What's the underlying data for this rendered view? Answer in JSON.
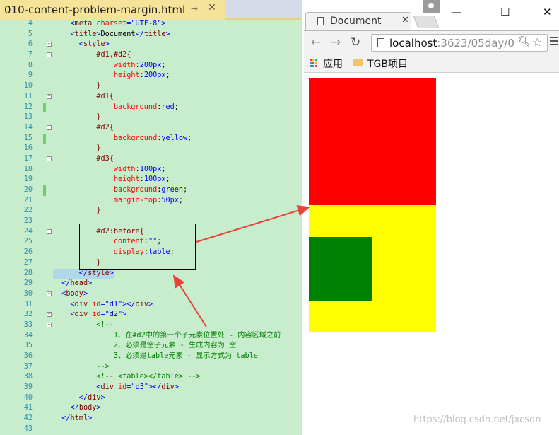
{
  "editor": {
    "tab_title": "010-content-problem-margin.html",
    "lines": [
      {
        "n": "4",
        "html": [
          [
            "t-pun",
            "    <"
          ],
          [
            "t-tag",
            "meta "
          ],
          [
            "t-attr",
            "charset"
          ],
          [
            "t-pun",
            "="
          ],
          [
            "t-str",
            "\"UTF-8\""
          ],
          [
            "t-pun",
            ">"
          ]
        ]
      },
      {
        "n": "5",
        "html": [
          [
            "t-pun",
            "    <"
          ],
          [
            "t-tag",
            "title"
          ],
          [
            "t-pun",
            ">"
          ],
          [
            "t-text",
            "Document"
          ],
          [
            "t-pun",
            "</"
          ],
          [
            "t-tag",
            "title"
          ],
          [
            "t-pun",
            ">"
          ]
        ]
      },
      {
        "n": "6",
        "html": [
          [
            "t-pun",
            "      <"
          ],
          [
            "t-tag",
            "style"
          ],
          [
            "t-pun",
            ">"
          ]
        ]
      },
      {
        "n": "7",
        "html": [
          [
            "t-sel",
            "          #d1,#d2{"
          ]
        ]
      },
      {
        "n": "8",
        "html": [
          [
            "t-prop",
            "              width"
          ],
          [
            "t-text",
            ":"
          ],
          [
            "t-val",
            "200px"
          ],
          [
            "t-text",
            ";"
          ]
        ]
      },
      {
        "n": "9",
        "html": [
          [
            "t-prop",
            "              height"
          ],
          [
            "t-text",
            ":"
          ],
          [
            "t-val",
            "200px"
          ],
          [
            "t-text",
            ";"
          ]
        ]
      },
      {
        "n": "10",
        "html": [
          [
            "t-sel",
            "          }"
          ]
        ]
      },
      {
        "n": "11",
        "html": [
          [
            "t-sel",
            "          #d1{"
          ]
        ]
      },
      {
        "n": "12",
        "html": [
          [
            "t-prop",
            "              background"
          ],
          [
            "t-text",
            ":"
          ],
          [
            "t-val",
            "red"
          ],
          [
            "t-text",
            ";"
          ]
        ]
      },
      {
        "n": "13",
        "html": [
          [
            "t-sel",
            "          }"
          ]
        ]
      },
      {
        "n": "14",
        "html": [
          [
            "t-sel",
            "          #d2{"
          ]
        ]
      },
      {
        "n": "15",
        "html": [
          [
            "t-prop",
            "              background"
          ],
          [
            "t-text",
            ":"
          ],
          [
            "t-val",
            "yellow"
          ],
          [
            "t-text",
            ";"
          ]
        ]
      },
      {
        "n": "16",
        "html": [
          [
            "t-sel",
            "          }"
          ]
        ]
      },
      {
        "n": "17",
        "html": [
          [
            "t-sel",
            "          #d3{"
          ]
        ]
      },
      {
        "n": "18",
        "html": [
          [
            "t-prop",
            "              width"
          ],
          [
            "t-text",
            ":"
          ],
          [
            "t-val",
            "100px"
          ],
          [
            "t-text",
            ";"
          ]
        ]
      },
      {
        "n": "19",
        "html": [
          [
            "t-prop",
            "              height"
          ],
          [
            "t-text",
            ":"
          ],
          [
            "t-val",
            "100px"
          ],
          [
            "t-text",
            ";"
          ]
        ]
      },
      {
        "n": "20",
        "html": [
          [
            "t-prop",
            "              background"
          ],
          [
            "t-text",
            ":"
          ],
          [
            "t-val",
            "green"
          ],
          [
            "t-text",
            ";"
          ]
        ]
      },
      {
        "n": "21",
        "html": [
          [
            "t-prop",
            "              margin-top"
          ],
          [
            "t-text",
            ":"
          ],
          [
            "t-val",
            "50px"
          ],
          [
            "t-text",
            ";"
          ]
        ]
      },
      {
        "n": "22",
        "html": [
          [
            "t-sel",
            "          }"
          ]
        ]
      },
      {
        "n": "23",
        "html": [
          [
            "t-text",
            ""
          ]
        ]
      },
      {
        "n": "24",
        "html": [
          [
            "t-sel",
            "          #d2:before{"
          ]
        ]
      },
      {
        "n": "25",
        "html": [
          [
            "t-prop",
            "              content"
          ],
          [
            "t-text",
            ":"
          ],
          [
            "t-val",
            "\"\""
          ],
          [
            "t-text",
            ";"
          ]
        ]
      },
      {
        "n": "26",
        "html": [
          [
            "t-prop",
            "              display"
          ],
          [
            "t-text",
            ":"
          ],
          [
            "t-val",
            "table"
          ],
          [
            "t-text",
            ";"
          ]
        ]
      },
      {
        "n": "27",
        "html": [
          [
            "t-sel",
            "          }"
          ]
        ]
      },
      {
        "n": "28",
        "html": [
          [
            "t-pun",
            "      </"
          ],
          [
            "t-tag",
            "style"
          ],
          [
            "t-pun",
            ">"
          ]
        ]
      },
      {
        "n": "29",
        "html": [
          [
            "t-pun",
            "  </"
          ],
          [
            "t-tag",
            "head"
          ],
          [
            "t-pun",
            ">"
          ]
        ]
      },
      {
        "n": "30",
        "html": [
          [
            "t-pun",
            "  <"
          ],
          [
            "t-tag",
            "body"
          ],
          [
            "t-pun",
            ">"
          ]
        ]
      },
      {
        "n": "31",
        "html": [
          [
            "t-pun",
            "    <"
          ],
          [
            "t-tag",
            "div "
          ],
          [
            "t-attr",
            "id"
          ],
          [
            "t-pun",
            "="
          ],
          [
            "t-str",
            "\"d1\""
          ],
          [
            "t-pun",
            "></"
          ],
          [
            "t-tag",
            "div"
          ],
          [
            "t-pun",
            ">"
          ]
        ]
      },
      {
        "n": "32",
        "html": [
          [
            "t-pun",
            "    <"
          ],
          [
            "t-tag",
            "div "
          ],
          [
            "t-attr",
            "id"
          ],
          [
            "t-pun",
            "="
          ],
          [
            "t-str",
            "\"d2\""
          ],
          [
            "t-pun",
            ">"
          ]
        ]
      },
      {
        "n": "33",
        "html": [
          [
            "t-cmt",
            "          <!--"
          ]
        ]
      },
      {
        "n": "34",
        "html": [
          [
            "t-cmt",
            "              1、在#d2中的第一个子元素位置处 - 内容区域之前"
          ]
        ]
      },
      {
        "n": "35",
        "html": [
          [
            "t-cmt",
            "              2、必须是空子元素 - 生成内容为 空"
          ]
        ]
      },
      {
        "n": "36",
        "html": [
          [
            "t-cmt",
            "              3、必须是table元素 - 显示方式为 table"
          ]
        ]
      },
      {
        "n": "37",
        "html": [
          [
            "t-cmt",
            "          -->"
          ]
        ]
      },
      {
        "n": "38",
        "html": [
          [
            "t-cmt",
            "          <!-- <table></table> -->"
          ]
        ]
      },
      {
        "n": "39",
        "html": [
          [
            "t-pun",
            "          <"
          ],
          [
            "t-tag",
            "div "
          ],
          [
            "t-attr",
            "id"
          ],
          [
            "t-pun",
            "="
          ],
          [
            "t-str",
            "\"d3\""
          ],
          [
            "t-pun",
            "></"
          ],
          [
            "t-tag",
            "div"
          ],
          [
            "t-pun",
            ">"
          ]
        ]
      },
      {
        "n": "40",
        "html": [
          [
            "t-pun",
            "      </"
          ],
          [
            "t-tag",
            "div"
          ],
          [
            "t-pun",
            ">"
          ]
        ]
      },
      {
        "n": "41",
        "html": [
          [
            "t-pun",
            "    </"
          ],
          [
            "t-tag",
            "body"
          ],
          [
            "t-pun",
            ">"
          ]
        ]
      },
      {
        "n": "42",
        "html": [
          [
            "t-pun",
            "  </"
          ],
          [
            "t-tag",
            "html"
          ],
          [
            "t-pun",
            ">"
          ]
        ]
      },
      {
        "n": "43",
        "html": [
          [
            "t-text",
            ""
          ]
        ]
      }
    ],
    "fold_lines": [
      "6",
      "7",
      "11",
      "14",
      "17",
      "24",
      "30",
      "32",
      "33"
    ],
    "changed_lines": [
      "12",
      "15",
      "20"
    ],
    "highlight_line": "28"
  },
  "browser": {
    "tab_title": "Document",
    "url_host": "localhost",
    "url_rest": ":3623/05day/0",
    "bookmarks": [
      {
        "label": "应用",
        "icon": "apps-icon"
      },
      {
        "label": "TGB项目",
        "icon": "folder-icon"
      }
    ],
    "boxes": {
      "d1_color": "#ff0000",
      "d2_color": "#ffff00",
      "d3_color": "#008000"
    },
    "watermark": "https://blog.csdn.net/jxcsdn"
  },
  "colors": {
    "editor_bg": "#c7edcc",
    "editor_tab": "#f6e39a",
    "arrow": "#e8423a"
  }
}
